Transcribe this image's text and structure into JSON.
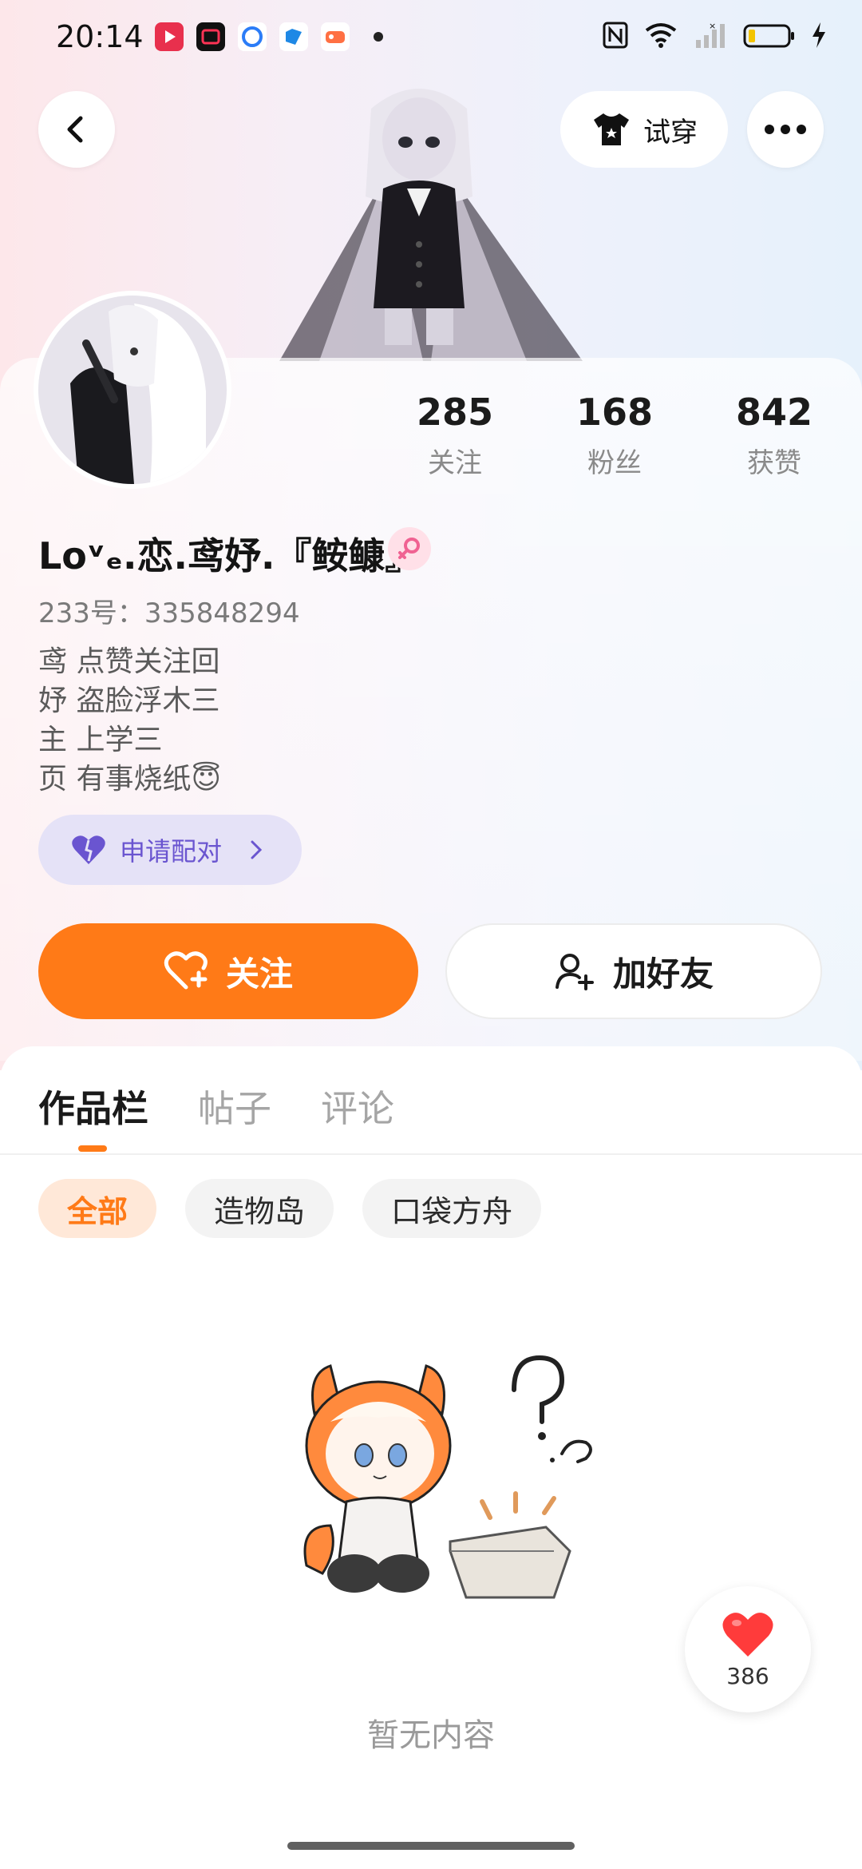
{
  "status_bar": {
    "time": "20:14",
    "icons": [
      "video-app-icon",
      "record-app-icon",
      "browser-app-icon",
      "files-app-icon",
      "game-app-icon",
      "more-dot",
      "nfc-icon",
      "wifi-icon",
      "signal-icon",
      "battery-icon",
      "charging-icon"
    ]
  },
  "header": {
    "tryon_label": "试穿"
  },
  "stats": [
    {
      "value": "285",
      "label": "关注"
    },
    {
      "value": "168",
      "label": "粉丝"
    },
    {
      "value": "842",
      "label": "获赞"
    }
  ],
  "profile": {
    "username": "Loᵛₑ.恋.鸢妤.『𩽾𩾌』",
    "uid_label": "233号：335848294",
    "bio_lines": [
      "鸢 点赞关注回",
      "妤 盗脸浮木三",
      "主 上学三",
      "页 有事烧纸😇"
    ]
  },
  "pair": {
    "label": "申请配对"
  },
  "actions": {
    "follow": "关注",
    "add_friend": "加好友"
  },
  "tabs": [
    "作品栏",
    "帖子",
    "评论"
  ],
  "filters": [
    "全部",
    "造物岛",
    "口袋方舟"
  ],
  "empty": {
    "text": "暂无内容"
  },
  "like_fab": {
    "count": "386"
  },
  "colors": {
    "accent": "#ff7a17",
    "pair_purple": "#6a55d0",
    "pair_bg": "#e5e2f7"
  }
}
